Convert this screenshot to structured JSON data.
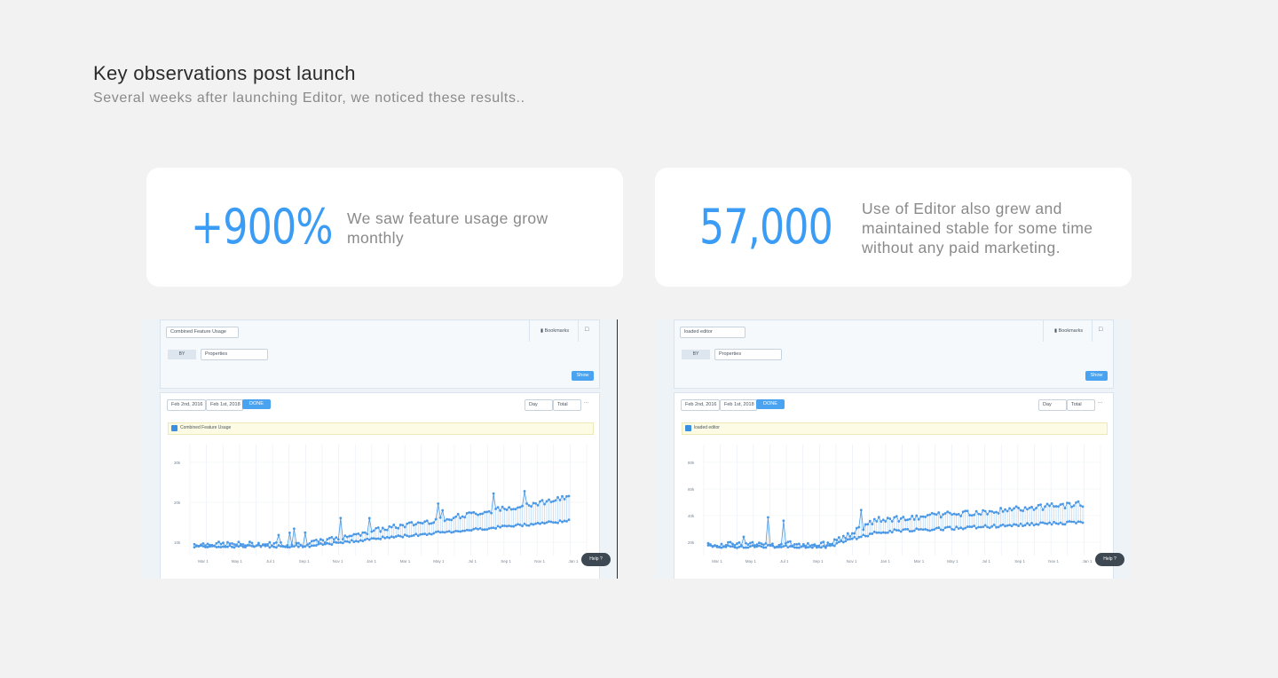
{
  "header": {
    "title": "Key observations post launch",
    "subtitle": "Several weeks after launching Editor, we noticed these results.."
  },
  "stats": [
    {
      "number": "+900%",
      "description": "We saw feature usage grow monthly"
    },
    {
      "number": "57,000",
      "description": "Use of Editor also grew and maintained stable for some time without any paid marketing."
    }
  ],
  "screenshots": [
    {
      "event_select": "Combined Feature Usage",
      "bookmarks_label": "Bookmarks",
      "by_label": "BY",
      "properties_select": "Properties",
      "show_button": "Show",
      "date_from": "Feb 2nd, 2016",
      "date_to": "Feb 1st, 2018",
      "done_button": "DONE",
      "interval_select": "Day",
      "aggregation_select": "Total",
      "legend_label": "Combined Feature Usage",
      "help_label": "Help",
      "y_ticks": [
        "30k",
        "20k",
        "10k"
      ],
      "x_ticks": [
        "Mar 1",
        "May 1",
        "Jul 1",
        "Sep 1",
        "Nov 1",
        "Jan 1",
        "Mar 1",
        "May 1",
        "Jul 1",
        "Sep 1",
        "Nov 1",
        "Jan 1"
      ],
      "accent": "#4a98e6"
    },
    {
      "event_select": "loaded editor",
      "bookmarks_label": "Bookmarks",
      "by_label": "BY",
      "properties_select": "Properties",
      "show_button": "Show",
      "date_from": "Feb 2nd, 2016",
      "date_to": "Feb 1st, 2018",
      "done_button": "DONE",
      "interval_select": "Day",
      "aggregation_select": "Total",
      "legend_label": "loaded editor",
      "help_label": "Help",
      "y_ticks": [
        "80k",
        "60k",
        "40k",
        "20k"
      ],
      "x_ticks": [
        "Mar 1",
        "May 1",
        "Jul 1",
        "Sep 1",
        "Nov 1",
        "Jan 1",
        "Mar 1",
        "May 1",
        "Jul 1",
        "Sep 1",
        "Nov 1",
        "Jan 1"
      ],
      "accent": "#4a98e6"
    }
  ]
}
